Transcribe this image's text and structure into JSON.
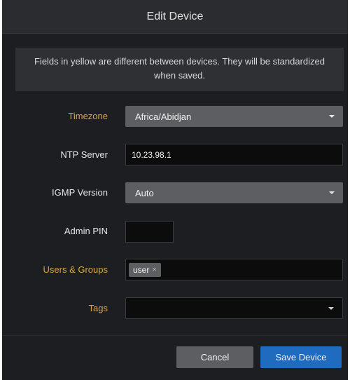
{
  "dialog": {
    "title": "Edit Device",
    "notice": "Fields in yellow are different between devices. They will be standardized when saved."
  },
  "fields": {
    "timezone": {
      "label": "Timezone",
      "value": "Africa/Abidjan"
    },
    "ntp_server": {
      "label": "NTP Server",
      "value": "10.23.98.1"
    },
    "igmp_version": {
      "label": "IGMP Version",
      "value": "Auto"
    },
    "admin_pin": {
      "label": "Admin PIN",
      "value": ""
    },
    "users_groups": {
      "label": "Users & Groups",
      "tags": [
        "user"
      ],
      "remove_glyph": "×"
    },
    "tags": {
      "label": "Tags",
      "value": ""
    }
  },
  "buttons": {
    "cancel": "Cancel",
    "save": "Save Device"
  },
  "icons": {
    "dropdown": "chevron-down-icon",
    "tag_remove": "close-icon"
  },
  "colors": {
    "background": "#1d1e21",
    "header": "#2b2c2f",
    "changed_label": "#d9a54a",
    "primary_button": "#1f6bbf"
  }
}
